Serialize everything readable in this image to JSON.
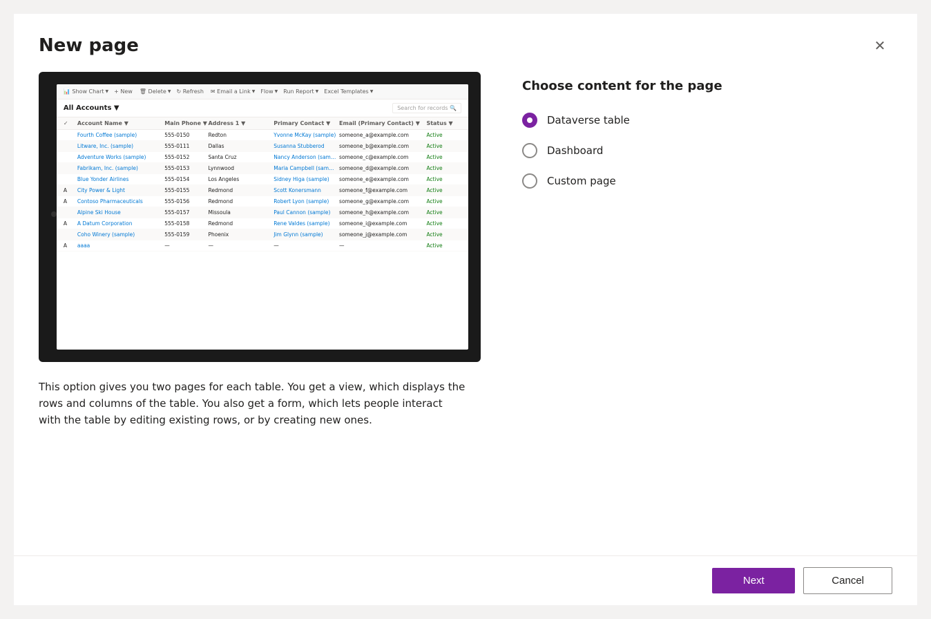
{
  "dialog": {
    "title": "New page",
    "close_icon": "✕"
  },
  "preview": {
    "toolbar_items": [
      "Show Chart",
      "+ New",
      "Delete",
      "Refresh",
      "Email a Link",
      "Flow",
      "Run Report",
      "Excel Templates"
    ],
    "header_title": "All Accounts",
    "search_placeholder": "Search for records",
    "columns": [
      "",
      "Account Name",
      "Main Phone",
      "Address 1",
      "Primary Contact",
      "Email (Primary Contact)",
      "Status"
    ],
    "rows": [
      [
        "",
        "Fourth Coffee (sample)",
        "555-0150",
        "Redton",
        "Yvonne McKay (sample)",
        "someone_a@example.com",
        "Active"
      ],
      [
        "",
        "Litware, Inc. (sample)",
        "555-0111",
        "Dallas",
        "Susanna Stubberod (samp)",
        "someone_b@example.com",
        "Active"
      ],
      [
        "",
        "Adventure Works (sample)",
        "555-0152",
        "Santa Cruz",
        "Nancy Anderson (sample)",
        "someone_c@example.com",
        "Active"
      ],
      [
        "",
        "Fabrikam, Inc. (sample)",
        "555-0153",
        "Lynnwood",
        "Maria Campbell (sample)",
        "someone_d@example.com",
        "Active"
      ],
      [
        "",
        "Blue Yonder Airlines (sample)",
        "555-0154",
        "Los Angeles",
        "Sidney Higa (sample)",
        "someone_e@example.com",
        "Active"
      ],
      [
        "A",
        "City Power & Light (sample)",
        "555-0155",
        "Redmond",
        "Scott Konersmann (sample)",
        "someone_f@example.com",
        "Active"
      ],
      [
        "A",
        "Contoso Pharmaceuticals (sample)",
        "555-0156",
        "Redmond",
        "Robert Lyon (sample)",
        "someone_g@example.com",
        "Active"
      ],
      [
        "",
        "Alpine Ski House (sample)",
        "555-0157",
        "Missoula",
        "Paul Cannon (sample)",
        "someone_h@example.com",
        "Active"
      ],
      [
        "A",
        "A Datum Corporation",
        "555-0158",
        "Redmond",
        "Rene Valdes (sample)",
        "someone_i@example.com",
        "Active"
      ],
      [
        "",
        "Coho Winery (sample)",
        "555-0159",
        "Phoenix",
        "Jim Glynn (sample)",
        "someone_j@example.com",
        "Active"
      ],
      [
        "A",
        "aaaa",
        "—",
        "—",
        "—",
        "—",
        "Active"
      ]
    ]
  },
  "description": "This option gives you two pages for each table. You get a view, which displays the rows and columns of the table. You also get a form, which lets people interact with the table by editing existing rows, or by creating new ones.",
  "content_options": {
    "title": "Choose content for the page",
    "options": [
      {
        "id": "dataverse",
        "label": "Dataverse table",
        "selected": true
      },
      {
        "id": "dashboard",
        "label": "Dashboard",
        "selected": false
      },
      {
        "id": "custom",
        "label": "Custom page",
        "selected": false
      }
    ]
  },
  "footer": {
    "next_label": "Next",
    "cancel_label": "Cancel"
  }
}
